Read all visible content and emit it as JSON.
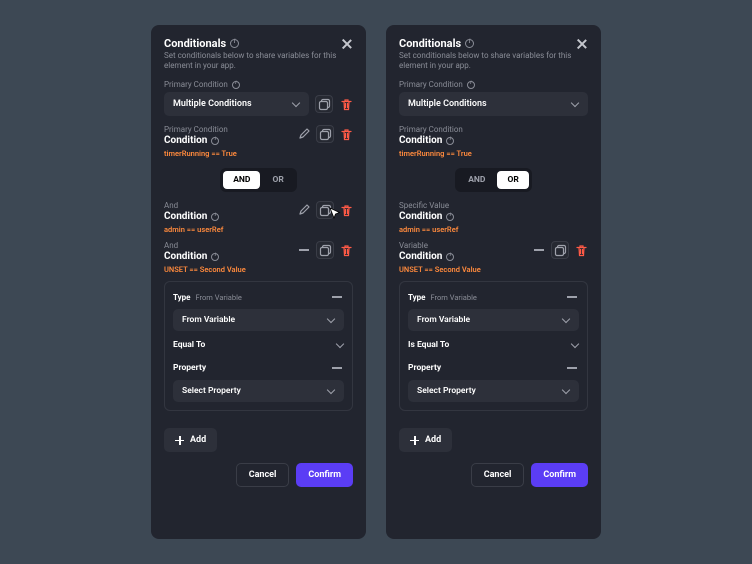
{
  "shared": {
    "title": "Conditionals",
    "subtitle": "Set conditionals below to share variables for this element in your app.",
    "primaryConditionLabel": "Primary Condition",
    "selectValue": "Multiple Conditions",
    "logicAnd": "AND",
    "logicOr": "OR",
    "type": "Type",
    "typeHint": "From Variable",
    "typeValue": "From Variable",
    "property": "Property",
    "propertyValue": "Select Property",
    "add": "Add",
    "cancel": "Cancel",
    "confirm": "Confirm"
  },
  "left": {
    "activeLogic": "AND",
    "cond1": {
      "label": "Primary Condition",
      "title": "Condition",
      "expr": "timerRunning == True"
    },
    "cond2": {
      "label": "And",
      "title": "Condition",
      "expr": "admin == userRef"
    },
    "cond3": {
      "label": "And",
      "title": "Condition",
      "expr": "UNSET == Second Value"
    },
    "compare": "Equal To"
  },
  "right": {
    "activeLogic": "OR",
    "cond1": {
      "label": "Primary Condition",
      "title": "Condition",
      "expr": "timerRunning == True"
    },
    "cond2": {
      "label": "Specific Value",
      "title": "Condition",
      "expr": "admin == userRef"
    },
    "cond3": {
      "label": "Variable",
      "title": "Condition",
      "expr": "UNSET == Second Value"
    },
    "compare": "Is Equal To"
  }
}
